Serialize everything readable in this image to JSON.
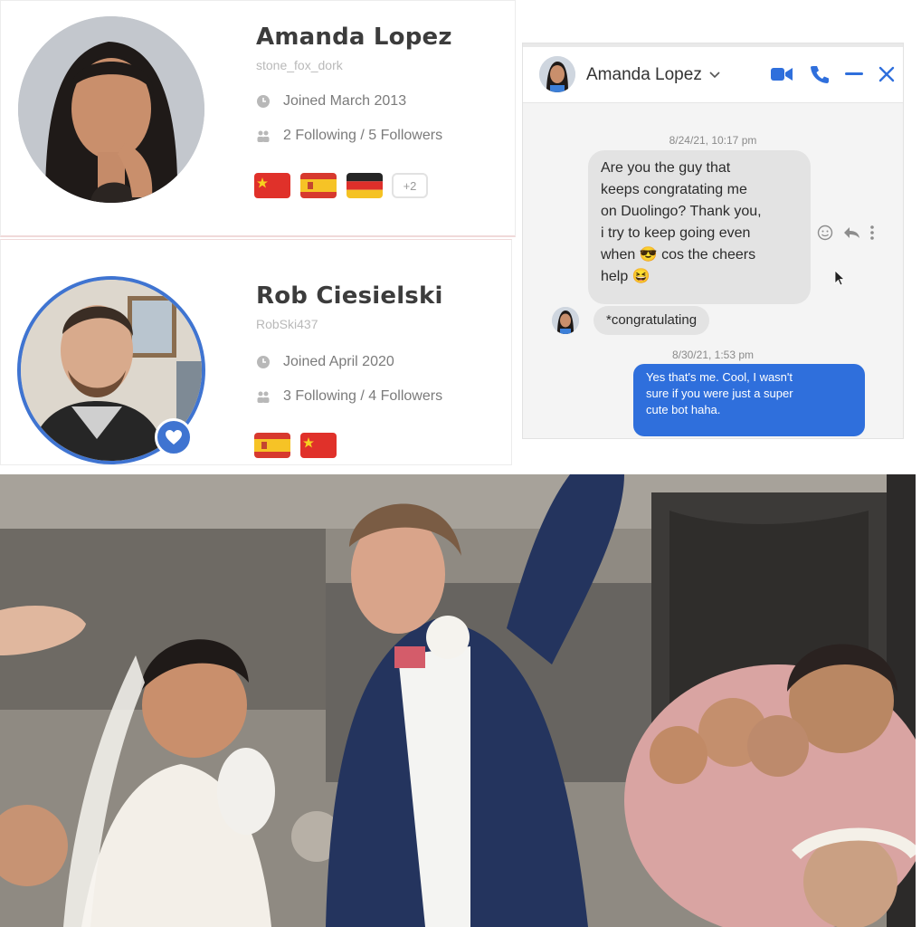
{
  "profiles": [
    {
      "name": "Amanda Lopez",
      "username": "stone_fox_dork",
      "joined": "Joined March 2013",
      "follow": "2 Following / 5 Followers",
      "flags": [
        "flag-china",
        "flag-spain",
        "flag-germany"
      ],
      "extra_languages": "+2"
    },
    {
      "name": "Rob Ciesielski",
      "username": "RobSki437",
      "joined": "Joined April 2020",
      "follow": "3 Following / 4 Followers",
      "flags": [
        "flag-spain",
        "flag-china"
      ]
    }
  ],
  "chat": {
    "contact": "Amanda Lopez",
    "messages": [
      {
        "timestamp": "8/24/21, 10:17 pm",
        "from": "Amanda Lopez",
        "lines": [
          "Are you the guy that",
          "keeps congratating me",
          "on Duolingo? Thank you,",
          "i try to keep going even",
          "when 😎 cos the cheers",
          "help 😆"
        ]
      },
      {
        "from": "Amanda Lopez",
        "text": "*congratulating"
      },
      {
        "timestamp": "8/30/21, 1:53 pm",
        "from": "me",
        "lines": [
          "Yes that's me. Cool, I wasn't",
          "sure if you were just a super",
          "cute bot haha."
        ]
      }
    ]
  },
  "icons": [
    "clock-icon",
    "people-icon",
    "heart-icon",
    "video-call-icon",
    "phone-icon",
    "minimize-icon",
    "close-icon",
    "chevron-down-icon",
    "emoji-icon",
    "reply-icon",
    "more-icon",
    "cursor-icon"
  ],
  "colors": {
    "heading": "#3c3c3c",
    "muted": "#7b7b7b",
    "accent_blue": "#3f74d1",
    "messenger_blue": "#2f6fdc",
    "bubble_gray": "#e3e3e3"
  }
}
